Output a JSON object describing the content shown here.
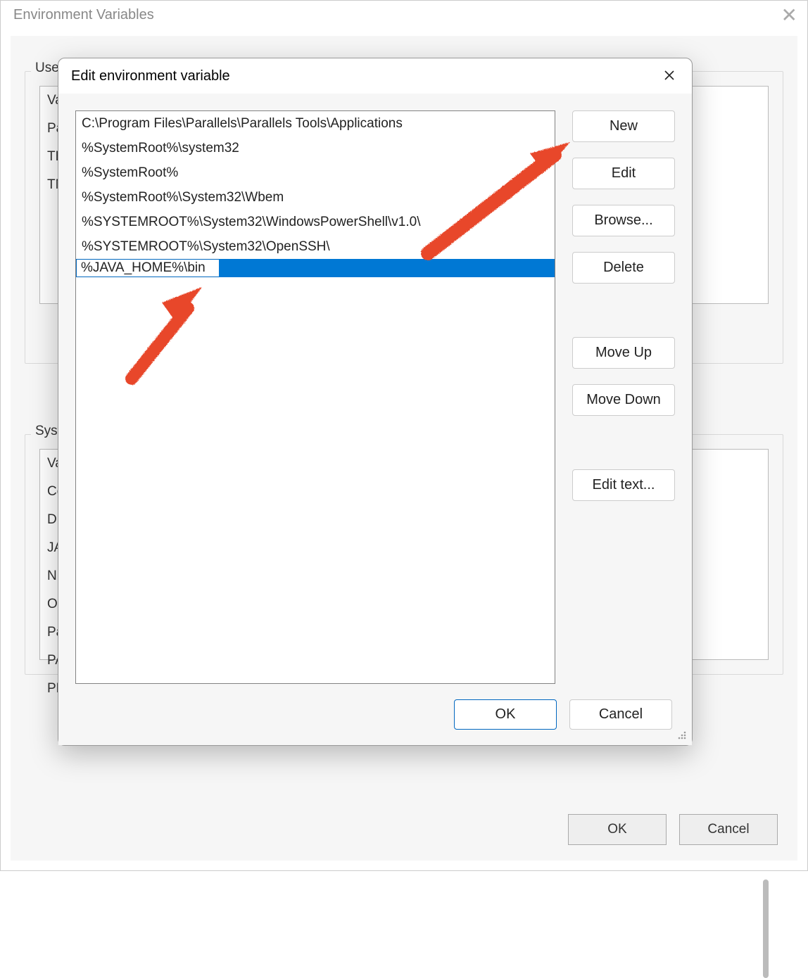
{
  "background_dialog": {
    "title": "Environment Variables",
    "user_section_label": "User",
    "user_vars": [
      "Va",
      "Pat",
      "TEI",
      "TM"
    ],
    "system_section_label": "Syste",
    "system_vars": [
      "Va",
      "Co",
      "Dri",
      "JA\\",
      "NU",
      "OS",
      "Pat",
      "PAT",
      "PR"
    ],
    "ok_label": "OK",
    "cancel_label": "Cancel"
  },
  "edit_dialog": {
    "title": "Edit environment variable",
    "path_entries": [
      "C:\\Program Files\\Parallels\\Parallels Tools\\Applications",
      "%SystemRoot%\\system32",
      "%SystemRoot%",
      "%SystemRoot%\\System32\\Wbem",
      "%SYSTEMROOT%\\System32\\WindowsPowerShell\\v1.0\\",
      "%SYSTEMROOT%\\System32\\OpenSSH\\"
    ],
    "editing_value": "%JAVA_HOME%\\bin",
    "buttons": {
      "new": "New",
      "edit": "Edit",
      "browse": "Browse...",
      "delete": "Delete",
      "move_up": "Move Up",
      "move_down": "Move Down",
      "edit_text": "Edit text..."
    },
    "ok_label": "OK",
    "cancel_label": "Cancel"
  }
}
